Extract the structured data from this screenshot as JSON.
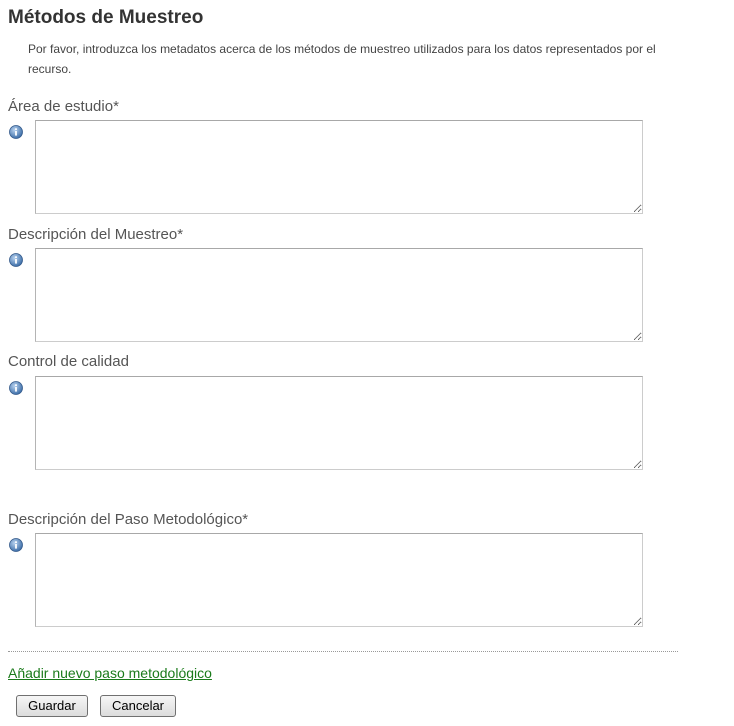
{
  "page": {
    "title": "Métodos de Muestreo",
    "intro": "Por favor, introduzca los metadatos acerca de los métodos de muestreo utilizados para los datos representados por el recurso."
  },
  "fields": [
    {
      "label": "Área de estudio*",
      "value": "",
      "icon": "info-icon"
    },
    {
      "label": "Descripción del Muestreo*",
      "value": "",
      "icon": "info-icon"
    },
    {
      "label": "Control de calidad",
      "value": "",
      "icon": "info-icon"
    },
    {
      "label": "Descripción del Paso Metodológico*",
      "value": "",
      "icon": "info-icon"
    }
  ],
  "actions": {
    "add_step_link": "Añadir nuevo paso metodológico",
    "save_label": "Guardar",
    "cancel_label": "Cancelar"
  },
  "colors": {
    "link": "#1a7a1a",
    "icon": "#4a78b0"
  }
}
